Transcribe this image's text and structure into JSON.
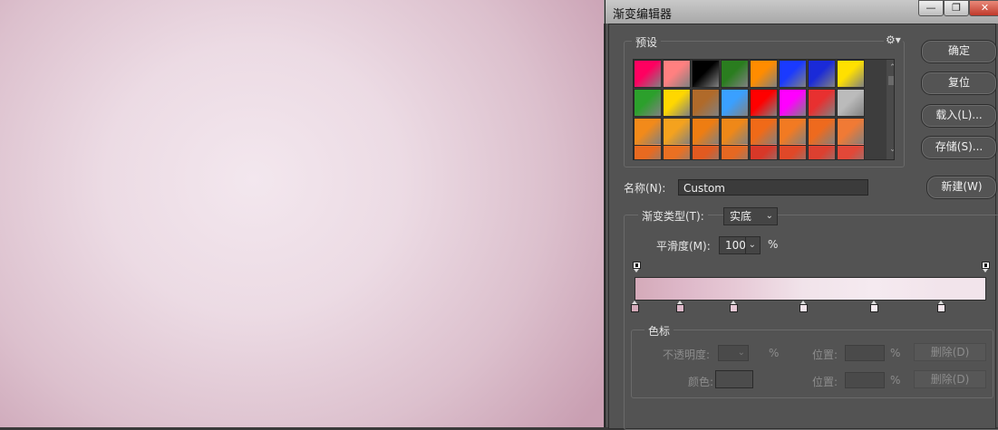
{
  "window": {
    "title": "渐变编辑器",
    "minimize": "—",
    "maximize": "❐",
    "close": "✕"
  },
  "presets": {
    "legend": "预设",
    "gear_icon": "gear-icon",
    "swatch_colors": [
      [
        "#ff0060",
        "#ff8080",
        "#000000",
        "#2a7d1f",
        "#ff8c00",
        "#1a3aff",
        "#1a2ad8",
        "#ffe000"
      ],
      [
        "#2ca02c",
        "#ffd700",
        "#b06a2a",
        "#3aa0ff",
        "#ff0000",
        "#ff00ff",
        "#e83030",
        "#bbbbbb"
      ],
      [
        "#f28a1a",
        "#f4a21e",
        "#ee7d12",
        "#ef8818",
        "#f06a18",
        "#f27a22",
        "#ee6a1e",
        "#f07a35"
      ],
      [
        "#e86a20",
        "#ea7022",
        "#e25a20",
        "#e66822",
        "#d83828",
        "#e04828",
        "#dc4030",
        "#e24838"
      ]
    ]
  },
  "buttons": {
    "ok": "确定",
    "reset": "复位",
    "load": "载入(L)...",
    "save": "存储(S)...",
    "new": "新建(W)"
  },
  "name": {
    "label": "名称(N):",
    "value": "Custom"
  },
  "gradient_type": {
    "label": "渐变类型(T):",
    "value": "实底"
  },
  "smoothness": {
    "label": "平滑度(M):",
    "value": "100",
    "unit": "%"
  },
  "gradient": {
    "start_color": "#d5afc2",
    "end_color": "#efdfe7",
    "color_stops": [
      {
        "position": 0.0,
        "color": "#d4aab9"
      },
      {
        "position": 0.13,
        "color": "#ddb7c8"
      },
      {
        "position": 0.28,
        "color": "#e6c8d5"
      },
      {
        "position": 0.48,
        "color": "#f1e3ea"
      },
      {
        "position": 0.68,
        "color": "#f5eaf0"
      },
      {
        "position": 0.87,
        "color": "#f2e4eb"
      }
    ],
    "opacity_stops": [
      0.0,
      1.0
    ]
  },
  "stops_group": {
    "legend": "色标",
    "opacity_label": "不透明度:",
    "opacity_unit": "%",
    "position_label_1": "位置:",
    "position_unit_1": "%",
    "delete_1": "删除(D)",
    "color_label": "颜色:",
    "position_label_2": "位置:",
    "position_unit_2": "%",
    "delete_2": "删除(D)"
  }
}
